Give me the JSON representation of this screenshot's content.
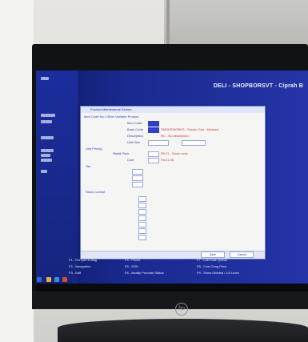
{
  "screen": {
    "header_title": "DELI - SHOPBORSVT - Ciprah B",
    "dialog": {
      "title": "Product Maintenance Screen",
      "subtitle": "Item Code No / Other Variable Product",
      "rows": [
        {
          "label": "Item Code"
        },
        {
          "label": "Bush Code"
        },
        {
          "label": "Description"
        },
        {
          "label": "Unit Size"
        },
        {
          "label": "Retail Price"
        },
        {
          "label": "Cost"
        }
      ],
      "section_labels": [
        "Unit Pricing",
        "Tax",
        "Stock Control"
      ],
      "red_lines": [
        "SMOKEWORKS - Smoke Gen - Mustard",
        "RC - No description",
        "PA 01 - Stock code",
        "PA 01 08"
      ],
      "footer_buttons": [
        "Save",
        "Cancel"
      ]
    },
    "fkeys": [
      "F1 - Fld Quit & Mag",
      "F2 - Navigation",
      "F3 - Edit",
      "F4 - Prices",
      "F5 - SOH",
      "F6 - Modify Promote Status",
      "F7 - Last Sale Queue",
      "F8 - Cost Chng Price",
      "F9 - Show Deleted / 1/2 Lines"
    ]
  },
  "brand": {
    "logo_text": "hp"
  },
  "colors": {
    "screen_bg": "#1a2a90",
    "dialog_bg": "#f5f5f3",
    "accent": "#2c40c8",
    "warning_text": "#c23838"
  }
}
